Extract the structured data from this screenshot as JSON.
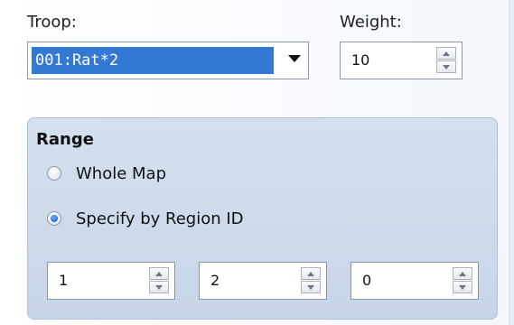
{
  "troop": {
    "label": "Troop:",
    "selected_value": "001:Rat*2"
  },
  "weight": {
    "label": "Weight:",
    "value": "10"
  },
  "range": {
    "title": "Range",
    "options": [
      {
        "label": "Whole Map",
        "selected": false
      },
      {
        "label": "Specify by Region ID",
        "selected": true
      }
    ],
    "region_ids": [
      "1",
      "2",
      "0"
    ]
  }
}
